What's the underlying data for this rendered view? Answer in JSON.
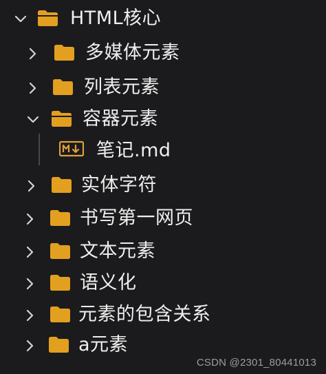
{
  "explorer": {
    "root": {
      "label": "HTML核心",
      "expanded": true
    },
    "items": [
      {
        "label": "多媒体元素",
        "type": "folder",
        "expanded": false
      },
      {
        "label": "列表元素",
        "type": "folder",
        "expanded": false
      },
      {
        "label": "容器元素",
        "type": "folder",
        "expanded": true
      },
      {
        "label": "笔记.md",
        "type": "markdown-file"
      },
      {
        "label": "实体字符",
        "type": "folder",
        "expanded": false
      },
      {
        "label": "书写第一网页",
        "type": "folder",
        "expanded": false
      },
      {
        "label": "文本元素",
        "type": "folder",
        "expanded": false
      },
      {
        "label": "语义化",
        "type": "folder",
        "expanded": false
      },
      {
        "label": "元素的包含关系",
        "type": "folder",
        "expanded": false
      },
      {
        "label": "a元素",
        "type": "folder",
        "expanded": false
      }
    ],
    "colors": {
      "background": "#1b1b1d",
      "folder": "#e3a020",
      "text": "#efefef",
      "file_icon": "#e2a23a",
      "chevron": "#d4d4d4"
    },
    "icons": {
      "expanded": "chevron-down-icon",
      "collapsed": "chevron-right-icon",
      "folder": "folder-icon",
      "markdown": "markdown-file-icon"
    }
  },
  "watermark": {
    "text": "CSDN @2301_80441013"
  }
}
